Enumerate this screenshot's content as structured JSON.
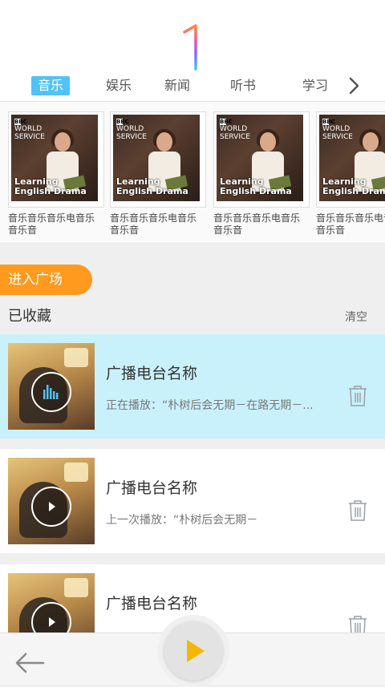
{
  "brand": {
    "logo_text": "1"
  },
  "tabs": [
    {
      "label": "音乐",
      "active": true
    },
    {
      "label": "娱乐",
      "active": false
    },
    {
      "label": "新闻",
      "active": false
    },
    {
      "label": "听书",
      "active": false
    },
    {
      "label": "学习",
      "active": false
    }
  ],
  "albums": [
    {
      "cover_brand": "BBC",
      "cover_service_1": "WORLD",
      "cover_service_2": "SERVICE",
      "cover_title_1": "Learning",
      "cover_title_2": "English Drama",
      "label": "音乐音乐音乐电音乐音乐音"
    },
    {
      "cover_brand": "BBC",
      "cover_service_1": "WORLD",
      "cover_service_2": "SERVICE",
      "cover_title_1": "Learning",
      "cover_title_2": "English Drama",
      "label": "音乐音乐音乐电音乐音乐音"
    },
    {
      "cover_brand": "BBC",
      "cover_service_1": "WORLD",
      "cover_service_2": "SERVICE",
      "cover_title_1": "Learning",
      "cover_title_2": "English Drama",
      "label": "音乐音乐音乐电音乐音乐音"
    },
    {
      "cover_brand": "BBC",
      "cover_service_1": "WORLD",
      "cover_service_2": "SERVICE",
      "cover_title_1": "Learning",
      "cover_title_2": "English Drama",
      "label": "音乐音乐音乐电音乐音乐音"
    }
  ],
  "enter_square": "进入广场",
  "favorites": {
    "title": "已收藏",
    "clear": "清空"
  },
  "stations": [
    {
      "name": "广播电台名称",
      "status": "正在播放：“朴树后会无期－在路无期－...",
      "playing": true
    },
    {
      "name": "广播电台名称",
      "status": "上一次播放：“朴树后会无期－",
      "playing": false
    },
    {
      "name": "广播电台名称",
      "status": "",
      "playing": false
    }
  ],
  "colors": {
    "accent": "#4fc3f7",
    "orange": "#ff9a1f",
    "active_row": "#c9f1fc",
    "play": "#f5b800"
  }
}
